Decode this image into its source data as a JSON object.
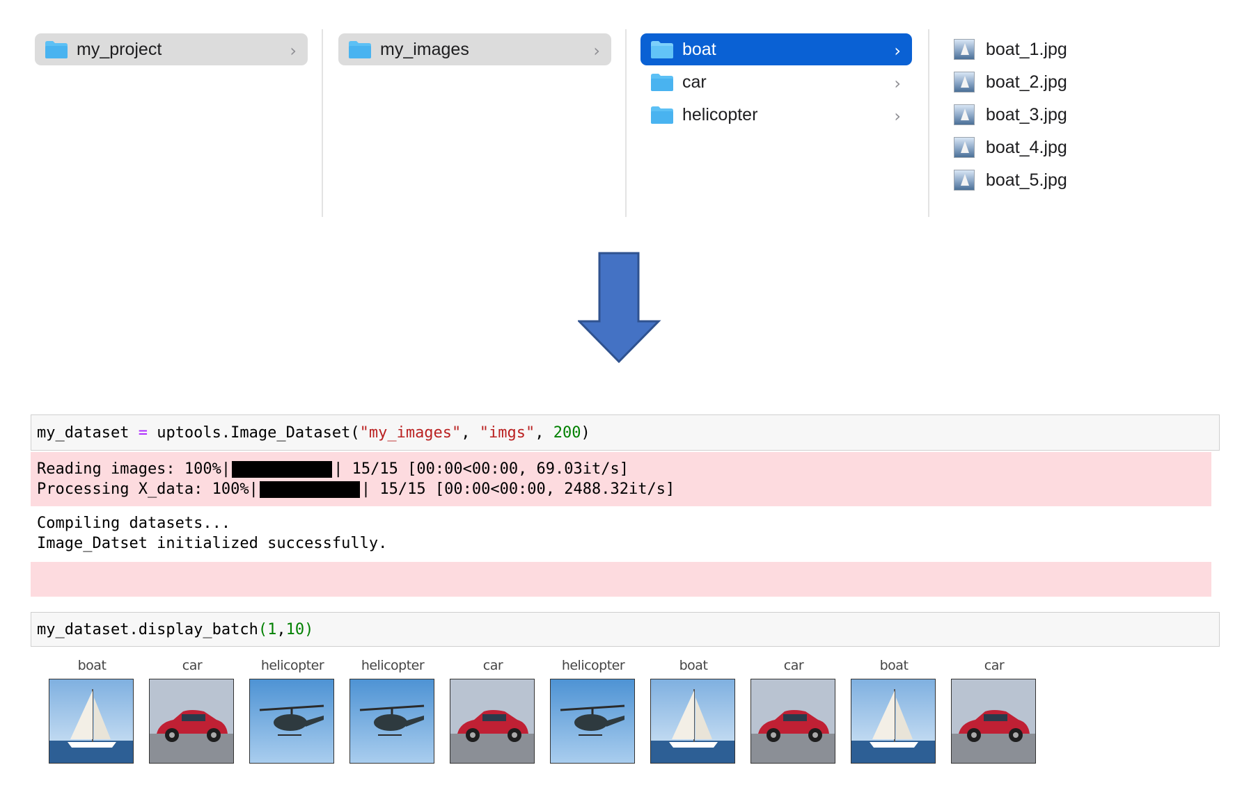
{
  "finder": {
    "col1": {
      "items": [
        {
          "label": "my_project",
          "icon": "folder-icon"
        }
      ]
    },
    "col2": {
      "items": [
        {
          "label": "my_images",
          "icon": "folder-icon"
        }
      ]
    },
    "col3": {
      "items": [
        {
          "label": "boat",
          "icon": "folder-icon",
          "selected": true
        },
        {
          "label": "car",
          "icon": "folder-icon"
        },
        {
          "label": "helicopter",
          "icon": "folder-icon"
        }
      ]
    },
    "col4": {
      "files": [
        {
          "label": "boat_1.jpg",
          "icon": "image-file-icon"
        },
        {
          "label": "boat_2.jpg",
          "icon": "image-file-icon"
        },
        {
          "label": "boat_3.jpg",
          "icon": "image-file-icon"
        },
        {
          "label": "boat_4.jpg",
          "icon": "image-file-icon"
        },
        {
          "label": "boat_5.jpg",
          "icon": "image-file-icon"
        }
      ]
    },
    "chevron": "›",
    "colors": {
      "selected_blue": "#0a61d4",
      "selected_gray": "#dcdcdc",
      "folder": "#5cc0f5"
    }
  },
  "arrow": {
    "icon": "down-arrow-icon",
    "color": "#4472c4"
  },
  "notebook": {
    "cell1": {
      "code": {
        "a": "my_dataset ",
        "op": "=",
        "b": " uptools.Image_Dataset(",
        "s1": "\"my_images\"",
        "c": ", ",
        "s2": "\"imgs\"",
        "d": ", ",
        "n": "200",
        "e": ")"
      },
      "stderr": [
        {
          "prefix": "Reading images: 100%|",
          "suffix": "| 15/15 [00:00<00:00, 69.03it/s]",
          "progress": 1.0
        },
        {
          "prefix": "Processing X_data: 100%|",
          "suffix": "| 15/15 [00:00<00:00, 2488.32it/s]",
          "progress": 1.0
        }
      ],
      "stdout": [
        "Compiling datasets...",
        "Image_Datset initialized successfully."
      ]
    },
    "cell2": {
      "code": {
        "a": "my_dataset.display_batch",
        "p1": "(",
        "n1": "1",
        "c": ",",
        "n2": "10",
        "p2": ")"
      }
    },
    "colors": {
      "error_bg": "#fddbdf",
      "string": "#ba2121",
      "number": "#008000",
      "operator": "#aa22ff"
    }
  },
  "batch": [
    {
      "label": "boat",
      "kind": "boat-image"
    },
    {
      "label": "car",
      "kind": "car-image"
    },
    {
      "label": "helicopter",
      "kind": "helicopter-image"
    },
    {
      "label": "helicopter",
      "kind": "helicopter-image"
    },
    {
      "label": "car",
      "kind": "car-image"
    },
    {
      "label": "helicopter",
      "kind": "helicopter-image"
    },
    {
      "label": "boat",
      "kind": "boat-image"
    },
    {
      "label": "car",
      "kind": "car-image"
    },
    {
      "label": "boat",
      "kind": "boat-image"
    },
    {
      "label": "car",
      "kind": "car-image"
    }
  ]
}
